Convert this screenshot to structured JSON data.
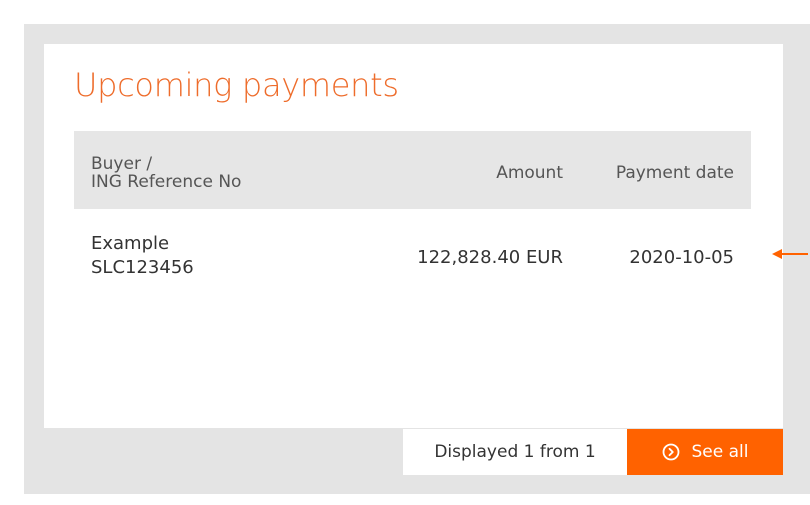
{
  "widget": {
    "title": "Upcoming payments"
  },
  "table": {
    "headers": {
      "buyer_line1": "Buyer /",
      "buyer_line2": "ING Reference No",
      "amount": "Amount",
      "payment_date": "Payment date"
    },
    "rows": [
      {
        "buyer": "Example",
        "reference": "SLC123456",
        "amount": "122,828.40 EUR",
        "payment_date": "2020-10-05"
      }
    ]
  },
  "footer": {
    "count_text": "Displayed 1 from 1",
    "see_all_label": "See all",
    "see_all_icon": "chevron-right-circle-icon"
  },
  "annotation": {
    "arrow_icon": "arrow-left-icon"
  },
  "colors": {
    "accent": "#ff6200",
    "title": "#ee6c2b",
    "header_bg": "#e6e6e6",
    "frame_bg": "#e4e4e4"
  }
}
